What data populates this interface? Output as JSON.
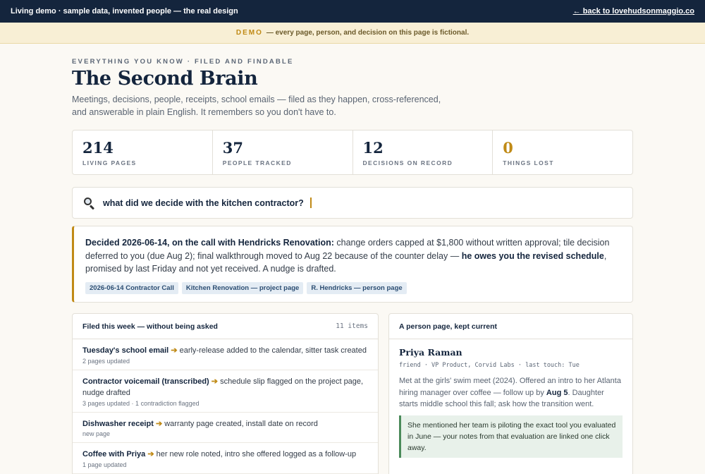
{
  "topbar": {
    "left_text": "Living demo · sample data, invented people — the real design",
    "back_link": "← back to lovehudsonmaggio.co"
  },
  "demo_banner": {
    "tag": "DEMO",
    "text": "— every page, person, and decision on this page is fictional."
  },
  "header": {
    "eyebrow": "EVERYTHING YOU KNOW · FILED AND FINDABLE",
    "title": "The Second Brain",
    "subtitle": "Meetings, decisions, people, receipts, school emails — filed as they happen, cross-referenced, and answerable in plain English. It remembers so you don't have to."
  },
  "stats": [
    {
      "value": "214",
      "label": "LIVING PAGES"
    },
    {
      "value": "37",
      "label": "PEOPLE TRACKED"
    },
    {
      "value": "12",
      "label": "DECISIONS ON RECORD"
    },
    {
      "value": "0",
      "label": "THINGS LOST"
    }
  ],
  "search": {
    "icon": "search-icon",
    "query": "what did we decide with the kitchen contractor?"
  },
  "answer": {
    "lead": "Decided 2026-06-14, on the call with Hendricks Renovation:",
    "mid": " change orders capped at $1,800 without written approval; tile decision deferred to you (due Aug 2); final walkthrough moved to Aug 22 because of the counter delay — ",
    "emphasis": "he owes you the revised schedule",
    "tail": ", promised by last Friday and not yet received. A nudge is drafted.",
    "sources": [
      "2026-06-14 Contractor Call",
      "Kitchen Renovation — project page",
      "R. Hendricks — person page"
    ]
  },
  "filed": {
    "title": "Filed this week — without being asked",
    "count": "11 items",
    "items": [
      {
        "title": "Tuesday's school email",
        "arrow": "➔",
        "text": "early-release added to the calendar, sitter task created",
        "meta": "2 pages updated"
      },
      {
        "title": "Contractor voicemail (transcribed)",
        "arrow": "➔",
        "text": "schedule slip flagged on the project page, nudge drafted",
        "meta": "3 pages updated · 1 contradiction flagged"
      },
      {
        "title": "Dishwasher receipt",
        "arrow": "➔",
        "text": "warranty page created, install date on record",
        "meta": "new page"
      },
      {
        "title": "Coffee with Priya",
        "arrow": "➔",
        "text": "her new role noted, intro she offered logged as a follow-up",
        "meta": "1 page updated"
      }
    ]
  },
  "person_card": {
    "title": "A person page, kept current",
    "name": "Priya Raman",
    "tags": "friend · VP Product, Corvid Labs · last touch: Tue",
    "body_pre": "Met at the girls' swim meet (2024). Offered an intro to her Atlanta hiring manager over coffee — follow up by ",
    "body_date": "Aug 5",
    "body_post": ". Daughter starts middle school this fall; ask how the transition went.",
    "note": "She mentioned her team is piloting the exact tool you evaluated in June — your notes from that evaluation are linked one click away."
  }
}
